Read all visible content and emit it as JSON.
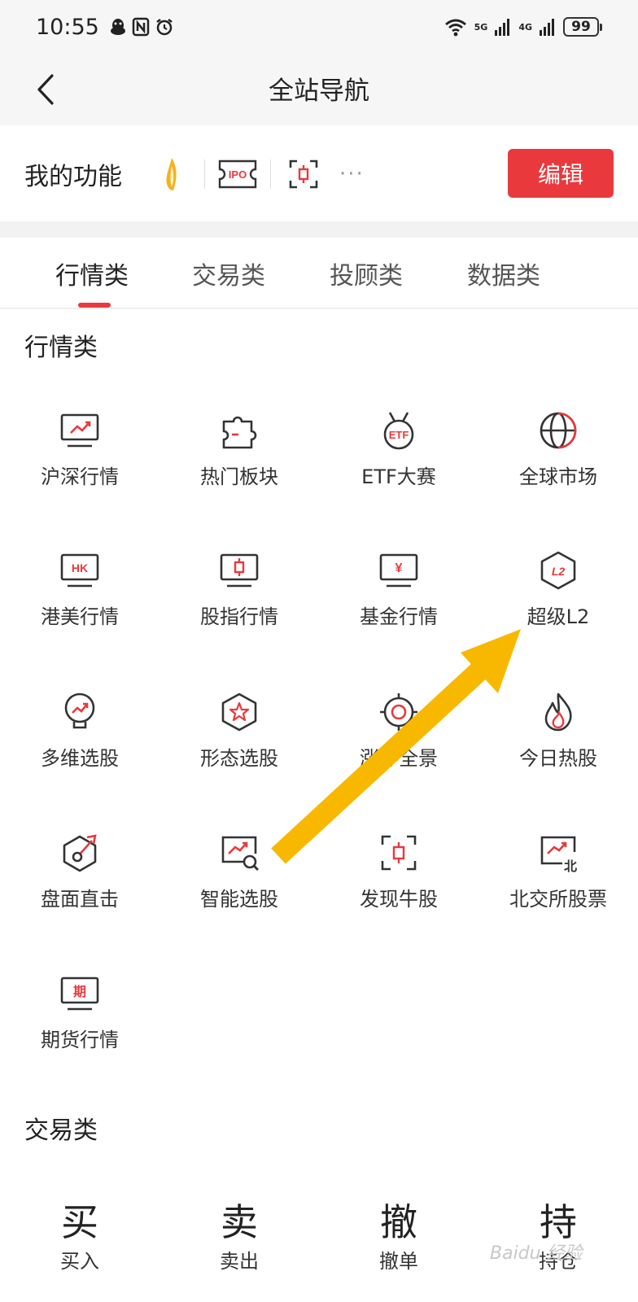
{
  "status_bar": {
    "time": "10:55",
    "signal_5g": "5G",
    "signal_4g": "4G",
    "battery": "99"
  },
  "header": {
    "title": "全站导航"
  },
  "my_functions": {
    "label": "我的功能",
    "ipo_text": "IPO",
    "more": "···",
    "edit_label": "编辑"
  },
  "tabs": [
    {
      "label": "行情类"
    },
    {
      "label": "交易类"
    },
    {
      "label": "投顾类"
    },
    {
      "label": "数据类"
    }
  ],
  "market_section": {
    "title": "行情类",
    "items": [
      {
        "label": "沪深行情"
      },
      {
        "label": "热门板块"
      },
      {
        "label": "ETF大赛",
        "badge": "ETF"
      },
      {
        "label": "全球市场"
      },
      {
        "label": "港美行情",
        "badge": "HK"
      },
      {
        "label": "股指行情"
      },
      {
        "label": "基金行情",
        "badge": "¥"
      },
      {
        "label": "超级L2",
        "badge": "L2"
      },
      {
        "label": "多维选股"
      },
      {
        "label": "形态选股"
      },
      {
        "label": "涨停全景"
      },
      {
        "label": "今日热股"
      },
      {
        "label": "盘面直击"
      },
      {
        "label": "智能选股"
      },
      {
        "label": "发现牛股"
      },
      {
        "label": "北交所股票",
        "badge": "北"
      },
      {
        "label": "期货行情",
        "badge": "期"
      }
    ]
  },
  "trade_section": {
    "title": "交易类",
    "items": [
      {
        "glyph": "买",
        "label": "买入"
      },
      {
        "glyph": "卖",
        "label": "卖出"
      },
      {
        "glyph": "撤",
        "label": "撤单"
      },
      {
        "glyph": "持",
        "label": "持仓"
      }
    ]
  },
  "watermark": "Baidu 经验",
  "colors": {
    "accent": "#e9393d",
    "annotation_arrow": "#f8b800"
  }
}
